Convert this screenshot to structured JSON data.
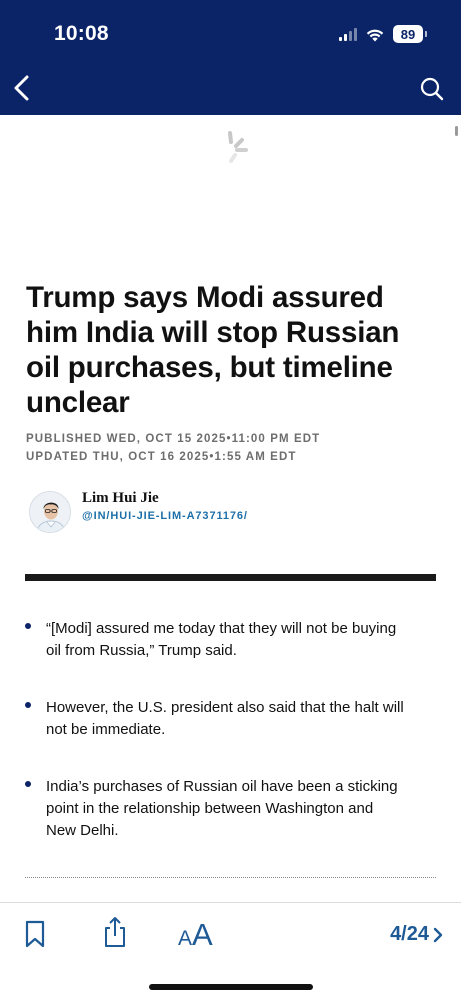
{
  "status_bar": {
    "time": "10:08",
    "battery": "89",
    "signal_icon": "cellular-signal-icon",
    "wifi_icon": "wifi-icon"
  },
  "nav": {
    "back_icon": "chevron-left-icon",
    "search_icon": "search-icon",
    "background_color": "#0a2467"
  },
  "article": {
    "headline": "Trump says Modi assured him India will stop Russian oil purchases, but timeline unclear",
    "published": "PUBLISHED WED, OCT 15 2025•11:00 PM EDT",
    "updated": "UPDATED THU, OCT 16 2025•1:55 AM EDT",
    "author": {
      "name": "Lim Hui Jie",
      "handle": "@IN/HUI-JIE-LIM-A7371176/"
    },
    "key_points": [
      "“[Modi] assured me today that they will not be buying oil from Russia,” Trump said.",
      "However, the U.S. president also said that the halt will not be immediate.",
      "India’s purchases of Russian oil have been a sticking point in the relationship between Washington and New Delhi."
    ]
  },
  "toolbar": {
    "bookmark_icon": "bookmark-icon",
    "share_icon": "share-icon",
    "text_size_small": "A",
    "text_size_large": "A",
    "page_indicator": "4/24",
    "next_icon": "chevron-right-icon",
    "accent_color": "#1d5a96"
  }
}
